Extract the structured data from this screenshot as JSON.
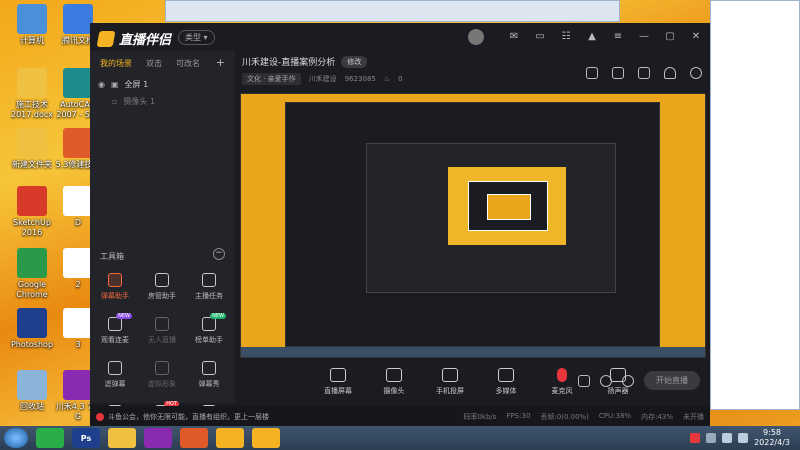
{
  "desktop": {
    "icons": [
      {
        "label": "计算机",
        "icon": "computer-icon",
        "color": "#4a8fd8"
      },
      {
        "label": "腾讯文档",
        "icon": "docs-icon",
        "color": "#3a7ce0"
      },
      {
        "label": "施工技术2017.docx",
        "icon": "folder-icon",
        "color": "#f0c040"
      },
      {
        "label": "AutoCAD 2007 - Si...",
        "icon": "autocad-icon",
        "color": "#1e8c8c"
      },
      {
        "label": "新建文件夹",
        "icon": "folder-icon",
        "color": "#f0c040"
      },
      {
        "label": "5.3修建技术",
        "icon": "app-icon",
        "color": "#e05a2a"
      },
      {
        "label": "SketchUp 2016",
        "icon": "sketchup-icon",
        "color": "#d83a2a"
      },
      {
        "label": "D",
        "icon": "pdf-icon",
        "color": "#ffffff"
      },
      {
        "label": "Google Chrome",
        "icon": "chrome-icon",
        "color": "#2a9a4a"
      },
      {
        "label": "2",
        "icon": "pdf-icon",
        "color": "#ffffff"
      },
      {
        "label": "Photoshop",
        "icon": "photoshop-icon",
        "color": "#1d3f8c"
      },
      {
        "label": "3",
        "icon": "pdf-icon",
        "color": "#ffffff"
      },
      {
        "label": "回收站",
        "icon": "recycle-bin-icon",
        "color": "#8ab4d8"
      },
      {
        "label": "川禾4.3 7平 G",
        "icon": "winrar-icon",
        "color": "#8a2ab0"
      }
    ]
  },
  "app": {
    "name": "直播伴侣",
    "type_pill": "类型 ▾",
    "room_title": "川禾建设-直播案例分析",
    "edit_label": "修改",
    "category": "文化 · 亲爱手作",
    "account": "川禾建设",
    "room_id": "9623085",
    "heat": "0",
    "tabs": [
      {
        "label": "我的场景",
        "active": true
      },
      {
        "label": "双击",
        "active": false
      },
      {
        "label": "可改名",
        "active": false
      }
    ],
    "scenes": [
      {
        "label": "全屏 1"
      },
      {
        "label": "摄像头 1"
      }
    ],
    "tools_title": "工具箱",
    "tools": [
      {
        "label": "弹幕助手",
        "icon": "danmu-icon",
        "state": "hot",
        "badge": ""
      },
      {
        "label": "房管助手",
        "icon": "manager-icon",
        "state": "normal",
        "badge": ""
      },
      {
        "label": "主播任务",
        "icon": "task-icon",
        "state": "normal",
        "badge": ""
      },
      {
        "label": "观看连麦",
        "icon": "link-icon",
        "state": "normal",
        "badge": "NEW"
      },
      {
        "label": "无人直播",
        "icon": "download-icon",
        "state": "dim",
        "badge": ""
      },
      {
        "label": "榜单助手",
        "icon": "rank-icon",
        "state": "normal",
        "badge": "NEW"
      },
      {
        "label": "滤弹幕",
        "icon": "filter-icon",
        "state": "normal",
        "badge": ""
      },
      {
        "label": "虚拟形象",
        "icon": "download-icon",
        "state": "dim",
        "badge": ""
      },
      {
        "label": "弹幕秀",
        "icon": "tv-icon",
        "state": "normal",
        "badge": ""
      },
      {
        "label": "",
        "icon": "grid-icon",
        "state": "normal",
        "badge": ""
      },
      {
        "label": "",
        "icon": "pk-icon",
        "state": "normal",
        "badge": "HOT"
      },
      {
        "label": "",
        "icon": "download-icon",
        "state": "normal",
        "badge": ""
      }
    ],
    "actions": [
      {
        "label": "直播屏幕",
        "icon": "screen-icon"
      },
      {
        "label": "摄像头",
        "icon": "camera-icon"
      },
      {
        "label": "手机投屏",
        "icon": "phone-icon"
      },
      {
        "label": "多媒体",
        "icon": "media-icon"
      },
      {
        "label": "麦克风",
        "icon": "microphone-icon"
      },
      {
        "label": "扬声器",
        "icon": "speaker-icon"
      }
    ],
    "go_live": "开始直播",
    "notice": "斗鱼公会，他你无限可能，直播有组织，更上一层楼",
    "stats": [
      "码率0kb/s",
      "FPS:30",
      "丢帧:0(0.00%)",
      "CPU:38%",
      "内存:43%",
      "未开播"
    ]
  },
  "taskbar": {
    "apps": [
      {
        "label": "",
        "icon": "wechat-icon",
        "color": "#2aae4a"
      },
      {
        "label": "Ps",
        "icon": "photoshop-icon",
        "color": "#1d3f8c"
      },
      {
        "label": "",
        "icon": "explorer-icon",
        "color": "#f0c040"
      },
      {
        "label": "",
        "icon": "winrar-icon",
        "color": "#8a2ab0"
      },
      {
        "label": "",
        "icon": "wps-icon",
        "color": "#e05a2a"
      },
      {
        "label": "",
        "icon": "live-companion-icon",
        "color": "#f5b324"
      },
      {
        "label": "",
        "icon": "live-companion-icon",
        "color": "#f5b324"
      }
    ],
    "time": "9:58",
    "date": "2022/4/3"
  }
}
